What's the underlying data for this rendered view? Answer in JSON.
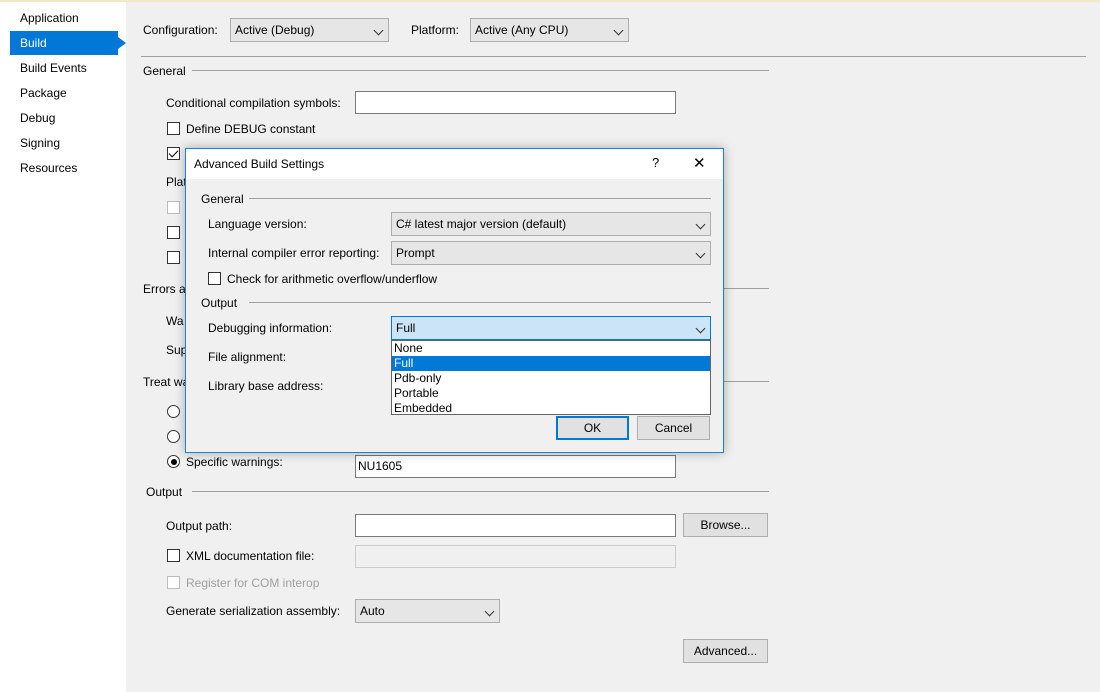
{
  "sidebar": {
    "items": [
      {
        "label": "Application"
      },
      {
        "label": "Build"
      },
      {
        "label": "Build Events"
      },
      {
        "label": "Package"
      },
      {
        "label": "Debug"
      },
      {
        "label": "Signing"
      },
      {
        "label": "Resources"
      }
    ],
    "active_index": 1,
    "accent": "#0078d7"
  },
  "toolbar": {
    "configuration_label": "Configuration:",
    "configuration_value": "Active (Debug)",
    "platform_label": "Platform:",
    "platform_value": "Active (Any CPU)"
  },
  "general": {
    "header": "General",
    "symbols_label": "Conditional compilation symbols:",
    "symbols_value": "",
    "define_debug_label": "Define DEBUG constant",
    "define_debug_checked": false,
    "define_trace_checked": true,
    "platform_partial": "Plat"
  },
  "errors": {
    "header_partial": "Errors a",
    "warning_partial": "Wa",
    "suppress_partial": "Sup"
  },
  "treat_warnings": {
    "header_partial": "Treat wa",
    "specific_label": "Specific warnings:",
    "specific_value": "NU1605"
  },
  "output": {
    "header": "Output",
    "path_label": "Output path:",
    "path_value": "",
    "browse_label": "Browse...",
    "xml_label": "XML documentation file:",
    "xml_value": "",
    "com_label": "Register for COM interop",
    "serialization_label": "Generate serialization assembly:",
    "serialization_value": "Auto",
    "advanced_label": "Advanced..."
  },
  "dialog": {
    "title": "Advanced Build Settings",
    "help_glyph": "?",
    "close_glyph": "✕",
    "general_header": "General",
    "language_label": "Language version:",
    "language_value": "C# latest major version (default)",
    "ice_label": "Internal compiler error reporting:",
    "ice_value": "Prompt",
    "overflow_label": "Check for arithmetic overflow/underflow",
    "output_header": "Output",
    "debug_info_label": "Debugging information:",
    "debug_info_value": "Full",
    "file_alignment_label": "File alignment:",
    "base_address_label": "Library base address:",
    "debug_options": [
      "None",
      "Full",
      "Pdb-only",
      "Portable",
      "Embedded"
    ],
    "debug_selected_index": 1,
    "ok_label": "OK",
    "cancel_label": "Cancel"
  }
}
